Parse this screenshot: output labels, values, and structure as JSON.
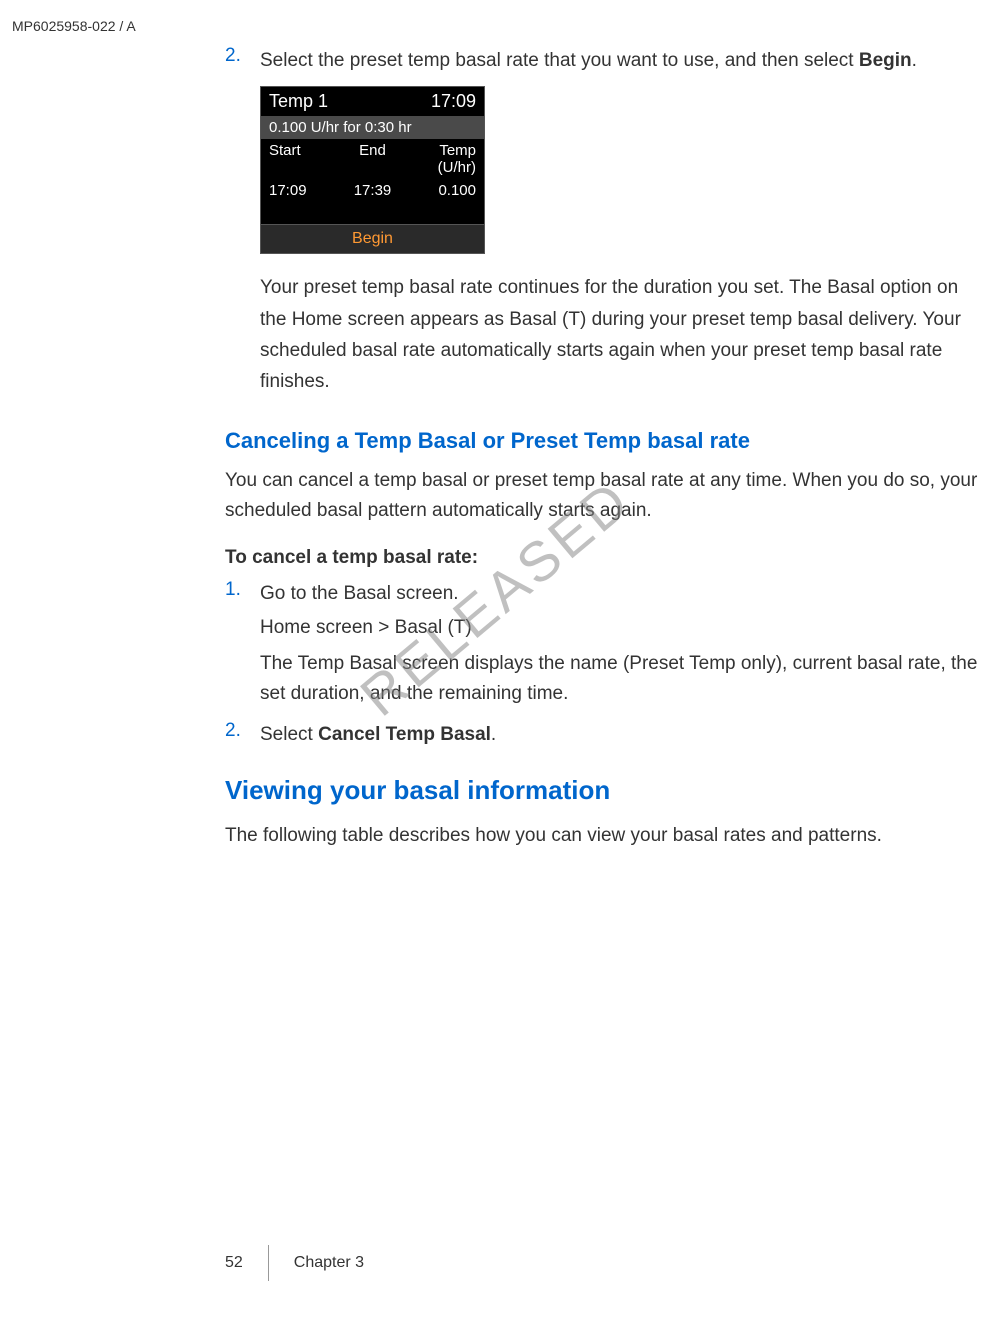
{
  "header": {
    "code": "MP6025958-022 / A"
  },
  "step2": {
    "number": "2.",
    "text_part1": "Select the preset temp basal rate that you want to use, and then select ",
    "text_bold": "Begin",
    "text_part2": "."
  },
  "device": {
    "title": "Temp 1",
    "time": "17:09",
    "subheader": "0.100 U/hr for 0:30 hr",
    "col1_header": "Start",
    "col2_header": "End",
    "col3_header": "Temp (U/hr)",
    "col1_value": "17:09",
    "col2_value": "17:39",
    "col3_value": "0.100",
    "button": "Begin"
  },
  "follow_text": "Your preset temp basal rate continues for the duration you set. The Basal option on the Home screen appears as Basal (T) during your preset temp basal delivery. Your scheduled basal rate automatically starts again when your preset temp basal rate finishes.",
  "cancel_section": {
    "heading": "Canceling a Temp Basal or Preset Temp basal rate",
    "intro": "You can cancel a temp basal or preset temp basal rate at any time. When you do so, your scheduled basal pattern automatically starts again.",
    "sub_heading": "To cancel a temp basal rate:",
    "item1_number": "1.",
    "item1_text": "Go to the Basal screen.",
    "nav_path": "Home screen > Basal (T)",
    "sub_text": "The Temp Basal screen displays the name (Preset Temp only), current basal rate, the set duration, and the remaining time.",
    "item2_number": "2.",
    "item2_text_part1": "Select ",
    "item2_bold": "Cancel Temp Basal",
    "item2_text_part2": "."
  },
  "viewing_section": {
    "heading": "Viewing your basal information",
    "text": "The following table describes how you can view your basal rates and patterns."
  },
  "watermark": "RELEASED",
  "footer": {
    "page": "52",
    "chapter": "Chapter 3"
  }
}
